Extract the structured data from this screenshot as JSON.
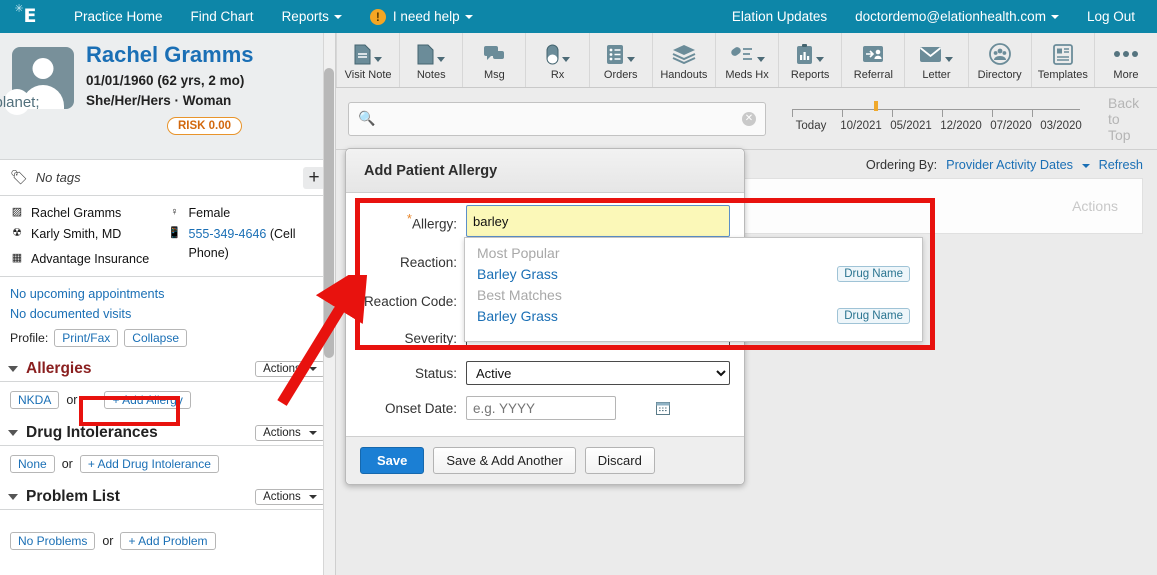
{
  "topnav": {
    "logo": "elation-logo-icon",
    "left_links": [
      {
        "label": "Practice Home",
        "caret": false
      },
      {
        "label": "Find Chart",
        "caret": false
      },
      {
        "label": "Reports",
        "caret": true
      }
    ],
    "help": {
      "badge": "!",
      "label": "I need help"
    },
    "right_links": [
      {
        "label": "Elation Updates",
        "caret": false
      },
      {
        "label": "doctordemo@elationhealth.com",
        "caret": true
      },
      {
        "label": "Log Out",
        "caret": false
      }
    ]
  },
  "patient": {
    "name": "Rachel Gramms",
    "dob_line": "01/01/1960 (62 yrs, 2 mo)",
    "pronouns_line": "She/Her/Hers · Woman",
    "risk_badge": "RISK 0.00",
    "tags_text": "No tags",
    "add_tag": "+",
    "demographics": {
      "left": [
        {
          "icon": "id-card-icon",
          "text": "Rachel Gramms",
          "link": false
        },
        {
          "icon": "stethoscope-icon",
          "text": "Karly Smith, MD",
          "link": false
        },
        {
          "icon": "insurance-card-icon",
          "text": "Advantage Insurance",
          "link": false
        }
      ],
      "right": [
        {
          "icon": "female-icon",
          "text": "Female",
          "link": false
        },
        {
          "icon": "mobile-phone-icon",
          "text": "555-349-4646",
          "suffix": " (Cell Phone)",
          "link": true
        }
      ]
    },
    "appointments": [
      "No upcoming appointments",
      "No documented visits"
    ],
    "profile_label": "Profile:",
    "profile_buttons": [
      "Print/Fax",
      "Collapse"
    ]
  },
  "sections": [
    {
      "title": "Allergies",
      "alert": true,
      "actions_label": "Actions",
      "buttons": [
        {
          "label": "NKDA",
          "highlight": false
        },
        {
          "label": "+ Add Allergy",
          "highlight": true
        }
      ],
      "or_text": "or"
    },
    {
      "title": "Drug Intolerances",
      "alert": false,
      "actions_label": "Actions",
      "buttons": [
        {
          "label": "None",
          "highlight": false
        },
        {
          "label": "+ Add Drug Intolerance",
          "highlight": false
        }
      ],
      "or_text": "or"
    },
    {
      "title": "Problem List",
      "alert": false,
      "actions_label": "Actions",
      "buttons": [
        {
          "label": "No Problems",
          "highlight": false
        },
        {
          "label": "+ Add Problem",
          "highlight": false
        }
      ],
      "or_text": "or"
    }
  ],
  "toolbar": [
    {
      "label": "Visit Note",
      "icon": "document-lines-icon",
      "caret": true
    },
    {
      "label": "Notes",
      "icon": "document-icon",
      "caret": true
    },
    {
      "label": "Msg",
      "icon": "chat-bubbles-icon",
      "caret": false
    },
    {
      "label": "Rx",
      "icon": "pill-capsule-icon",
      "caret": true
    },
    {
      "label": "Orders",
      "icon": "list-clipboard-icon",
      "caret": true
    },
    {
      "label": "Handouts",
      "icon": "stacked-layers-icon",
      "caret": false
    },
    {
      "label": "Meds Hx",
      "icon": "pill-list-icon",
      "caret": true
    },
    {
      "label": "Reports",
      "icon": "bar-chart-clipboard-icon",
      "caret": true
    },
    {
      "label": "Referral",
      "icon": "person-arrow-icon",
      "caret": false
    },
    {
      "label": "Letter",
      "icon": "envelope-icon",
      "caret": true
    },
    {
      "label": "Directory",
      "icon": "people-circle-icon",
      "caret": false
    },
    {
      "label": "Templates",
      "icon": "layout-grid-icon",
      "caret": false
    },
    {
      "label": "More",
      "icon": "ellipsis-icon",
      "caret": false
    }
  ],
  "search": {
    "icon": "search-icon",
    "value": "",
    "placeholder": "",
    "clear_icon": "clear-circle-icon"
  },
  "timeline": {
    "labels": [
      "Today",
      "10/2021",
      "05/2021",
      "12/2020",
      "07/2020",
      "03/2020"
    ],
    "marker_color": "#f0a92c",
    "back_to_top": "Back to Top"
  },
  "content": {
    "ordering_label": "Ordering By:",
    "ordering_value": "Provider Activity Dates",
    "refresh_label": "Refresh",
    "actions_header": "Actions"
  },
  "modal": {
    "title": "Add Patient Allergy",
    "fields": [
      {
        "label": "Allergy:",
        "required": true,
        "type": "text",
        "value": "barley",
        "name": "allergy-input"
      },
      {
        "label": "Reaction:",
        "required": false,
        "type": "text",
        "value": "",
        "name": "reaction-input"
      },
      {
        "label": "Reaction Code:",
        "required": false,
        "type": "text",
        "value": "",
        "name": "reaction-code-input"
      },
      {
        "label": "Severity:",
        "required": false,
        "type": "select",
        "value": "--",
        "options": [
          "--"
        ],
        "name": "severity-select"
      },
      {
        "label": "Status:",
        "required": false,
        "type": "select",
        "value": "Active",
        "options": [
          "Active"
        ],
        "name": "status-select"
      },
      {
        "label": "Onset Date:",
        "required": false,
        "type": "date",
        "value": "",
        "placeholder": "e.g. YYYY",
        "name": "onset-date-input"
      }
    ],
    "buttons": [
      {
        "label": "Save",
        "primary": true
      },
      {
        "label": "Save & Add Another",
        "primary": false
      },
      {
        "label": "Discard",
        "primary": false
      }
    ]
  },
  "autocomplete": {
    "groups": [
      {
        "header": "Most Popular",
        "items": [
          {
            "name": "Barley Grass",
            "badge": "Drug Name"
          }
        ]
      },
      {
        "header": "Best Matches",
        "items": [
          {
            "name": "Barley Grass",
            "badge": "Drug Name"
          }
        ]
      }
    ]
  },
  "annotation": {
    "color": "#e8120e",
    "arrow": "red-arrow-annotation"
  }
}
